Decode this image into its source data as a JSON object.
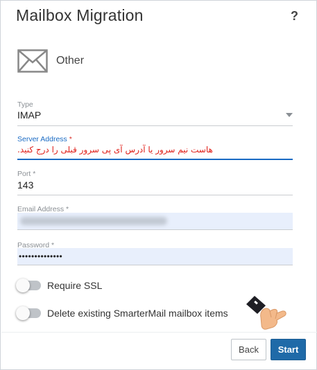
{
  "dialog": {
    "title": "Mailbox Migration",
    "help_label": "?"
  },
  "provider": {
    "icon": "mail-envelope-icon",
    "label": "Other"
  },
  "form": {
    "type": {
      "label": "Type",
      "value": "IMAP"
    },
    "server_address": {
      "label": "Server Address",
      "required_mark": "*",
      "note": "هاست نیم سرور یا آدرس آی پی سرور قبلی را درج کنید."
    },
    "port": {
      "label": "Port",
      "required_mark": "*",
      "value": "143"
    },
    "email_address": {
      "label": "Email Address",
      "required_mark": "*"
    },
    "password": {
      "label": "Password",
      "required_mark": "*",
      "value": "••••••••••••••"
    }
  },
  "toggles": {
    "require_ssl": {
      "label": "Require SSL",
      "on": false
    },
    "delete_existing": {
      "label": "Delete existing SmarterMail mailbox items",
      "on": false
    }
  },
  "buttons": {
    "back": "Back",
    "start": "Start"
  },
  "colors": {
    "accent": "#1a6bc4",
    "primary_button": "#1f6aa8",
    "required": "#d9302b",
    "note_text": "#e0201a",
    "autofill_bg": "#e8effc"
  },
  "overlay_icon": "hand-pointer-icon"
}
